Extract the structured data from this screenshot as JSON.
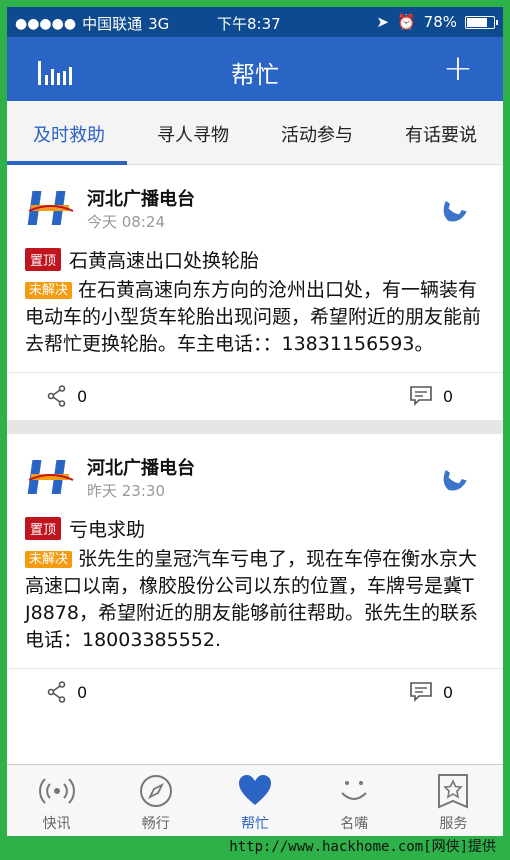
{
  "status_bar": {
    "carrier": "中国联通",
    "network": "3G",
    "time": "下午8:37",
    "battery": "78%",
    "battery_level": 0.78
  },
  "nav": {
    "title": "帮忙"
  },
  "tabs": [
    {
      "label": "及时救助",
      "active": true
    },
    {
      "label": "寻人寻物",
      "active": false
    },
    {
      "label": "活动参与",
      "active": false
    },
    {
      "label": "有话要说",
      "active": false
    }
  ],
  "posts": [
    {
      "source": "河北广播电台",
      "time": "今天 08:24",
      "pin_tag": "置顶",
      "title": "石黄高速出口处换轮胎",
      "status_tag": "未解决",
      "body": "在石黄高速向东方向的沧州出口处，有一辆装有电动车的小型货车轮胎出现问题，希望附近的朋友能前去帮忙更换轮胎。车主电话：：13831156593。",
      "shares": "0",
      "comments": "0"
    },
    {
      "source": "河北广播电台",
      "time": "昨天 23:30",
      "pin_tag": "置顶",
      "title": "亏电求助",
      "status_tag": "未解决",
      "body": "张先生的皇冠汽车亏电了，现在车停在衡水京大高速口以南，橡胶股份公司以东的位置，车牌号是冀T J8878，希望附近的朋友能够前往帮助。张先生的联系电话：18003385552.",
      "shares": "0",
      "comments": "0"
    }
  ],
  "tabbar": [
    {
      "label": "快讯",
      "icon": "radio-icon",
      "active": false
    },
    {
      "label": "畅行",
      "icon": "compass-icon",
      "active": false
    },
    {
      "label": "帮忙",
      "icon": "heart-icon",
      "active": true
    },
    {
      "label": "名嘴",
      "icon": "smile-icon",
      "active": false
    },
    {
      "label": "服务",
      "icon": "star-doc-icon",
      "active": false
    }
  ],
  "watermark": "http://www.hackhome.com[网侠]提供",
  "colors": {
    "nav_blue": "#2a64c4",
    "status_blue": "#0e4a8f",
    "pin_red": "#c0141e",
    "unsolved_orange": "#f39c12",
    "frame_green": "#2fb14a"
  }
}
